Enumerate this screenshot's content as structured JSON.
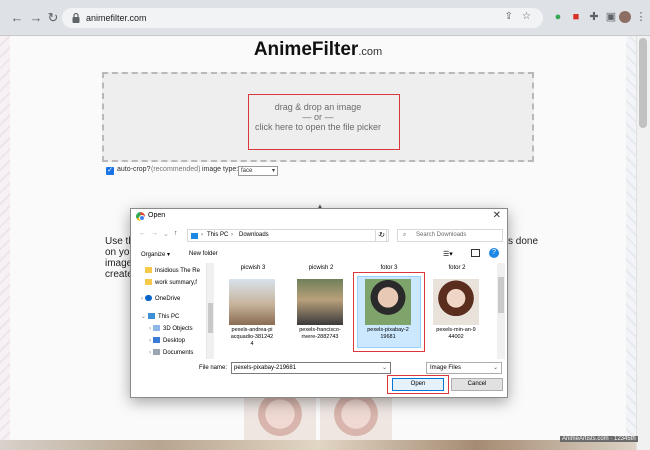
{
  "browser": {
    "url": "animefilter.com"
  },
  "site": {
    "title": "AnimeFilter",
    "title_suffix": ".com",
    "drop_line1": "drag & drop an image",
    "drop_line2": "— or —",
    "drop_line3": "click here to open the file picker",
    "autocrop_label": "auto-crop?",
    "autocrop_note": "(recommended)",
    "autocrop_checked": true,
    "image_type_label": "image type:",
    "image_type_value": "face",
    "bg_left": [
      "Use th",
      "on you",
      "images",
      "created"
    ],
    "bg_right": [
      "s done"
    ],
    "caption": "AnimeArtists.com · 12345th"
  },
  "dialog": {
    "title": "Open",
    "path": [
      "This PC",
      "Downloads"
    ],
    "search_placeholder": "Search Downloads",
    "organize": "Organize",
    "new_folder": "New folder",
    "tree": [
      {
        "label": "Insidious The Re",
        "icon": "folder-icon"
      },
      {
        "label": "work summary,f",
        "icon": "folder-icon"
      },
      {
        "label": "OneDrive",
        "icon": "cloud-icon"
      },
      {
        "label": "This PC",
        "icon": "pc-icon"
      },
      {
        "label": "3D Objects",
        "icon": "cube-icon"
      },
      {
        "label": "Desktop",
        "icon": "desktop-icon"
      },
      {
        "label": "Documents",
        "icon": "document-icon"
      }
    ],
    "top_row": [
      "picwish 3",
      "picwish 2",
      "fotor 3",
      "fotor 2"
    ],
    "files": [
      {
        "name": "pexels-andrea-piacquadio-3812424",
        "lines": [
          "pexels-andrea-pi",
          "acquadio-381242",
          "4"
        ]
      },
      {
        "name": "pexels-francisco-rivere-2882743",
        "lines": [
          "pexels-francisco-",
          "rivere-2882743"
        ]
      },
      {
        "name": "pexels-pixabay-219681",
        "lines": [
          "pexels-pixabay-2",
          "19681"
        ],
        "selected": true
      },
      {
        "name": "pexels-min-an-944002",
        "lines": [
          "pexels-min-an-9",
          "44002"
        ]
      }
    ],
    "file_name_label": "File name:",
    "file_name_value": "pexels-pixabay-219681",
    "file_type": "Image Files",
    "open_label": "Open",
    "cancel_label": "Cancel"
  },
  "colors": {
    "highlight": "#d9373b",
    "accent": "#1a73e8",
    "selected_tile": "#cce8ff"
  }
}
